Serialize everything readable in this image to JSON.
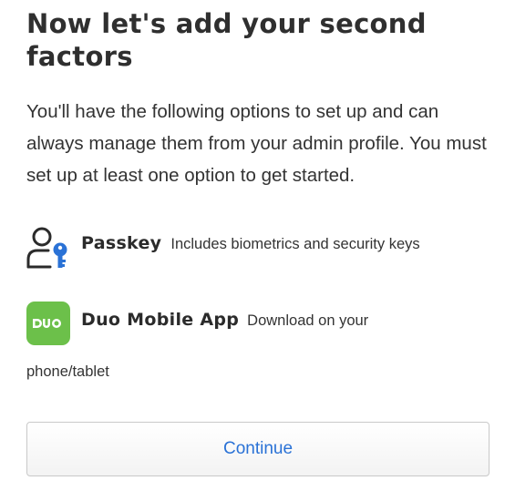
{
  "heading": "Now let's add your second factors",
  "description": "You'll have the following options to set up and can always manage them from your admin profile. You must set up at least one option to get started.",
  "options": [
    {
      "title": "Passkey",
      "description": "Includes biometrics and security keys",
      "icon": "person-key-icon",
      "icon_color": "#2a72d6"
    },
    {
      "title": "Duo Mobile App",
      "description": "Download on your",
      "description_continued": "phone/tablet",
      "icon": "duo-logo-icon",
      "icon_color": "#6cc04a"
    }
  ],
  "continue_button": {
    "label": "Continue",
    "text_color": "#2a72d6"
  }
}
